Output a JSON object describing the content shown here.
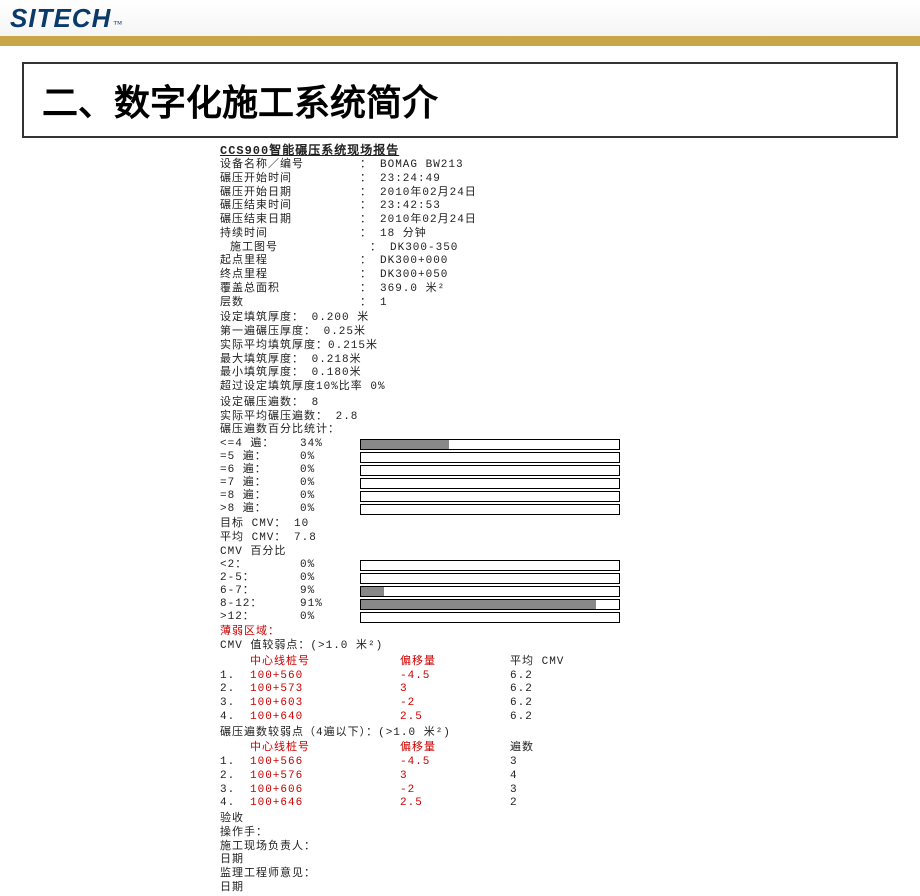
{
  "logo": {
    "main": "SITECH",
    "tm": "™"
  },
  "slide_title": "二、数字化施工系统简介",
  "report": {
    "title": "CCS900智能碾压系统现场报告",
    "info": [
      {
        "k": "设备名称／编号",
        "v": "BOMAG BW213"
      },
      {
        "k": "碾压开始时间",
        "v": "23:24:49"
      },
      {
        "k": "碾压开始日期",
        "v": "2010年02月24日"
      },
      {
        "k": "碾压结束时间",
        "v": "23:42:53"
      },
      {
        "k": "碾压结束日期",
        "v": "2010年02月24日"
      },
      {
        "k": "持续时间",
        "v": "18 分钟"
      },
      {
        "k": "施工图号",
        "v": "DK300-350"
      },
      {
        "k": "起点里程",
        "v": "DK300+000"
      },
      {
        "k": "终点里程",
        "v": "DK300+050"
      },
      {
        "k": "覆盖总面积",
        "v": "369.0 米²"
      },
      {
        "k": "层数",
        "v": "1"
      }
    ],
    "thickness": [
      "设定填筑厚度：   0.200 米",
      "第一遍碾压厚度： 0.25米",
      "实际平均填筑厚度：0.215米",
      "最大填筑厚度：   0.218米",
      "最小填筑厚度：   0.180米",
      "超过设定填筑厚度10%比率   0%"
    ],
    "passes_set": "设定碾压遍数：  8",
    "passes_avg": "实际平均碾压遍数：     2.8",
    "passes_header": "碾压遍数百分比统计：",
    "pass_bars": [
      {
        "lbl": "<=4 遍：",
        "pct": "34%",
        "fill": 34
      },
      {
        "lbl": "=5 遍：",
        "pct": "0%",
        "fill": 0
      },
      {
        "lbl": "=6 遍：",
        "pct": "0%",
        "fill": 0
      },
      {
        "lbl": "=7 遍：",
        "pct": "0%",
        "fill": 0
      },
      {
        "lbl": "=8 遍：",
        "pct": "0%",
        "fill": 0
      },
      {
        "lbl": ">8 遍：",
        "pct": "0%",
        "fill": 0
      }
    ],
    "cmv_target": "目标 CMV：   10",
    "cmv_avg": "平均 CMV：   7.8",
    "cmv_header": "CMV 百分比",
    "cmv_bars": [
      {
        "lbl": "<2：",
        "pct": "0%",
        "fill": 0
      },
      {
        "lbl": "2-5：",
        "pct": "0%",
        "fill": 0
      },
      {
        "lbl": "6-7：",
        "pct": "9%",
        "fill": 9
      },
      {
        "lbl": "8-12：",
        "pct": "91%",
        "fill": 91
      },
      {
        "lbl": ">12：",
        "pct": "0%",
        "fill": 0
      }
    ],
    "weak_zone_label": "薄弱区域：",
    "cmv_weak_title": "CMV 值较弱点：(>1.0 米²)",
    "cmv_weak_head": {
      "c1": "中心线桩号",
      "c2": "偏移量",
      "c3": "平均 CMV"
    },
    "cmv_weak_rows": [
      {
        "n": "1.",
        "c1": "100+560",
        "c2": "-4.5",
        "c3": "6.2"
      },
      {
        "n": "2.",
        "c1": "100+573",
        "c2": "3",
        "c3": "6.2"
      },
      {
        "n": "3.",
        "c1": "100+603",
        "c2": "-2",
        "c3": "6.2"
      },
      {
        "n": "4.",
        "c1": "100+640",
        "c2": "2.5",
        "c3": "6.2"
      }
    ],
    "pass_weak_title": "碾压遍数较弱点（4遍以下）：(>1.0 米²)",
    "pass_weak_head": {
      "c1": "中心线桩号",
      "c2": "偏移量",
      "c3": "遍数"
    },
    "pass_weak_rows": [
      {
        "n": "1.",
        "c1": "100+566",
        "c2": "-4.5",
        "c3": "3"
      },
      {
        "n": "2.",
        "c1": "100+576",
        "c2": "3",
        "c3": "4"
      },
      {
        "n": "3.",
        "c1": "100+606",
        "c2": "-2",
        "c3": "3"
      },
      {
        "n": "4.",
        "c1": "100+646",
        "c2": "2.5",
        "c3": "2"
      }
    ],
    "sig": [
      "验收",
      "操作手：",
      "施工现场负责人：",
      "日期",
      "监理工程师意见：",
      "日期"
    ]
  }
}
